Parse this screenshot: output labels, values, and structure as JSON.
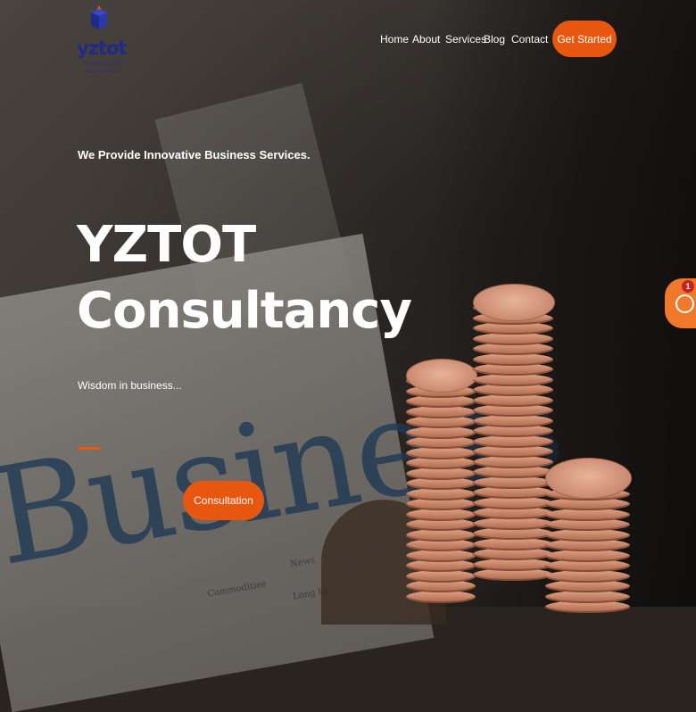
{
  "logo": {
    "wordmark": "yztot",
    "subtitle": "CONSULTANCY",
    "tagline": "... wisdom in business",
    "color": "#1e2b8a"
  },
  "nav": {
    "items": [
      "Home",
      "About",
      "Services",
      "Blog",
      "Contact"
    ],
    "cta_label": "Get Started"
  },
  "hero": {
    "kicker": "We Provide Innovative Business Services.",
    "title_line1": "YZTOT",
    "title_line2": "Consultancy",
    "tagline": "Wisdom in business...",
    "button_label": "Consultation",
    "background_word": "Business",
    "paper_columns": [
      "News",
      "Commodities",
      "Long ha"
    ]
  },
  "chat": {
    "icon": "chat-bubble-icon",
    "badge_count": "1"
  },
  "colors": {
    "accent": "#e8570f",
    "text": "#ffffff"
  }
}
